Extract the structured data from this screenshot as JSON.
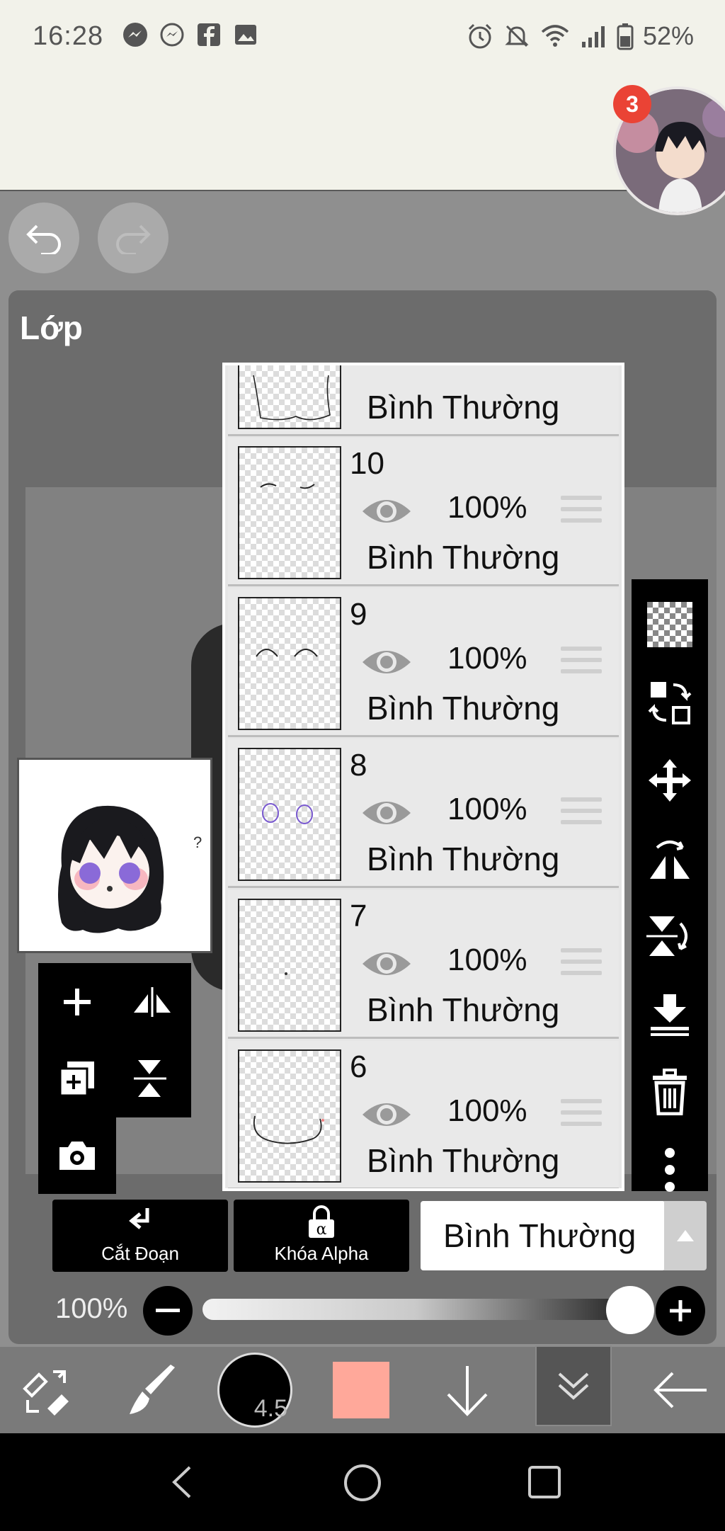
{
  "status_bar": {
    "time": "16:28",
    "battery": "52%",
    "left_icons": [
      "messenger-icon",
      "messenger-outline-icon",
      "facebook-icon",
      "gallery-icon"
    ],
    "right_icons": [
      "alarm-icon",
      "mute-icon",
      "wifi-icon",
      "signal-icon",
      "battery-icon"
    ]
  },
  "chat_head": {
    "badge_count": "3"
  },
  "panel": {
    "title": "Lớp"
  },
  "layers": [
    {
      "number": "",
      "opacity": "",
      "mode": "Bình Thường"
    },
    {
      "number": "10",
      "opacity": "100%",
      "mode": "Bình Thường"
    },
    {
      "number": "9",
      "opacity": "100%",
      "mode": "Bình Thường"
    },
    {
      "number": "8",
      "opacity": "100%",
      "mode": "Bình Thường"
    },
    {
      "number": "7",
      "opacity": "100%",
      "mode": "Bình Thường"
    },
    {
      "number": "6",
      "opacity": "100%",
      "mode": "Bình Thường"
    }
  ],
  "bottom_controls": {
    "clip_label": "Cắt Đoạn",
    "alpha_lock_label": "Khóa Alpha",
    "alpha_symbol": "α",
    "blend_mode": "Bình Thường",
    "opacity_label": "100%",
    "opacity_value": 1.0
  },
  "toolbar": {
    "brush_size": "4.5",
    "color": "#ffa89a"
  },
  "colors": {
    "panel_bg": "#6c6c6c",
    "accent_badge": "#ea4335"
  }
}
